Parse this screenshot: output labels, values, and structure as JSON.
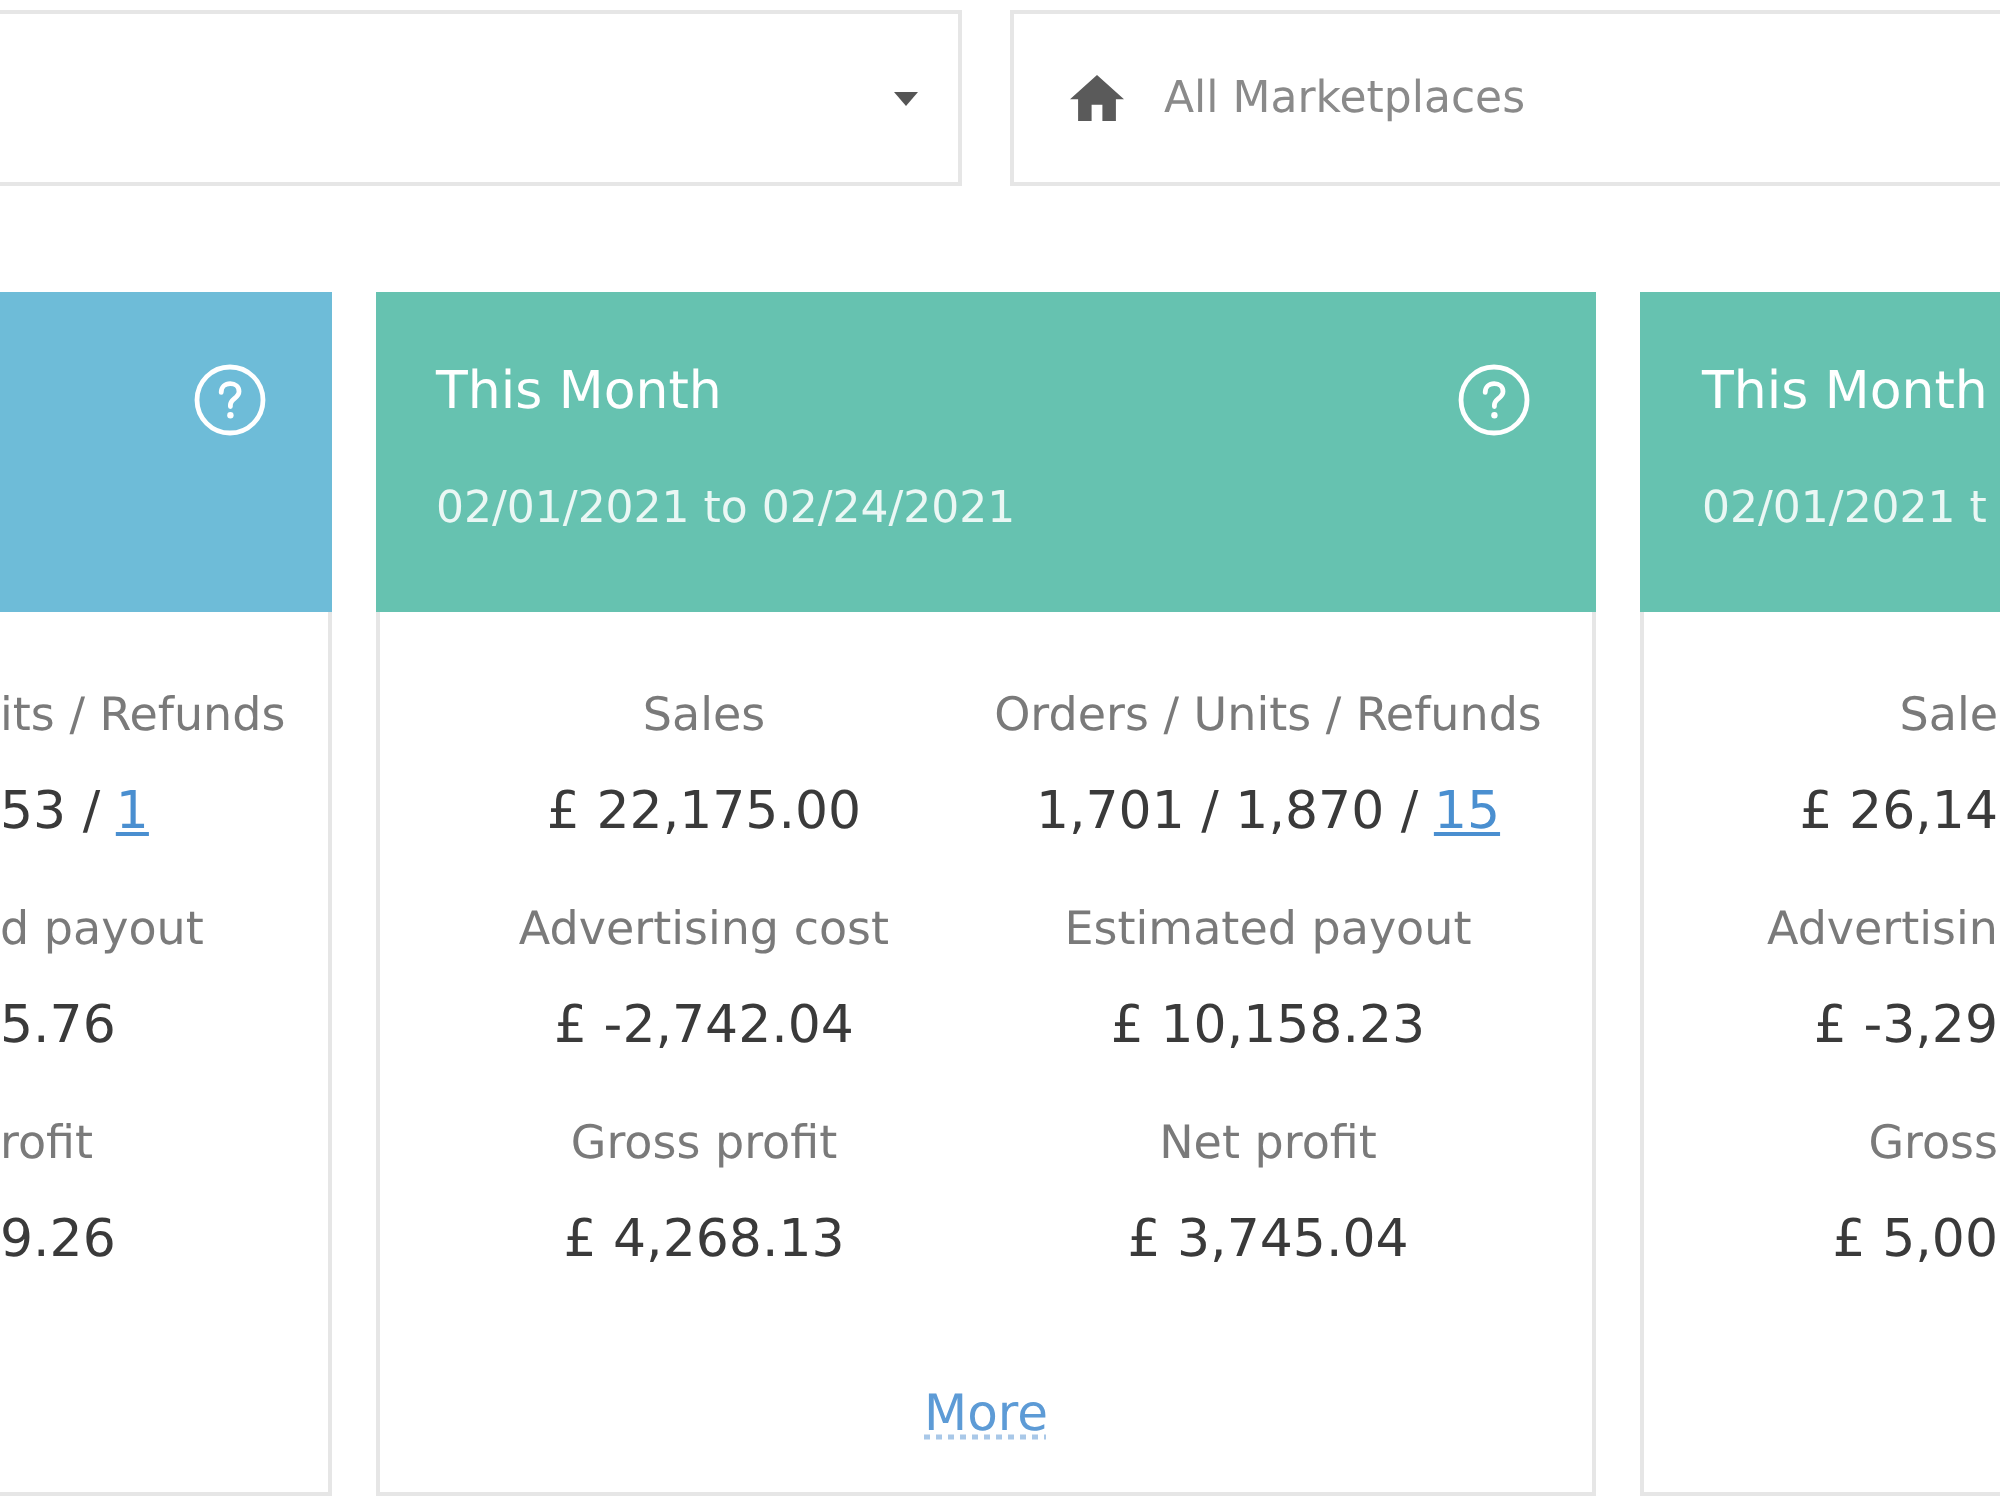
{
  "filters": {
    "marketplace": {
      "value": "All Marketplaces"
    }
  },
  "cards": [
    {
      "kind": "cut_left",
      "color": "#6ebcd8",
      "metrics": [
        {
          "label": "its / Refunds",
          "value": "53 /",
          "link": "1"
        },
        {
          "label": "d payout",
          "value": "5.76"
        },
        {
          "label": "rofit",
          "value": "9.26"
        }
      ]
    },
    {
      "kind": "full",
      "color": "#66c2b0",
      "title": "This Month",
      "date_range": "02/01/2021 to 02/24/2021",
      "metrics": [
        {
          "label": "Sales",
          "value": "£ 22,175.00"
        },
        {
          "label": "Orders / Units / Refunds",
          "value": "1,701 / 1,870 /",
          "link": "15"
        },
        {
          "label": "Advertising cost",
          "value": "£ -2,742.04"
        },
        {
          "label": "Estimated payout",
          "value": "£ 10,158.23"
        },
        {
          "label": "Gross profit",
          "value": "£ 4,268.13"
        },
        {
          "label": "Net profit",
          "value": "£ 3,745.04"
        }
      ],
      "more": "More"
    },
    {
      "kind": "cut_right",
      "color": "#66c2b0",
      "title": "This Month",
      "date_range": "02/01/2021 t",
      "metrics": [
        {
          "label": "Sale",
          "value": "£ 26,14"
        },
        {
          "label": "Advertisin",
          "value": "£ -3,29"
        },
        {
          "label": "Gross",
          "value": "£ 5,00"
        }
      ]
    }
  ]
}
